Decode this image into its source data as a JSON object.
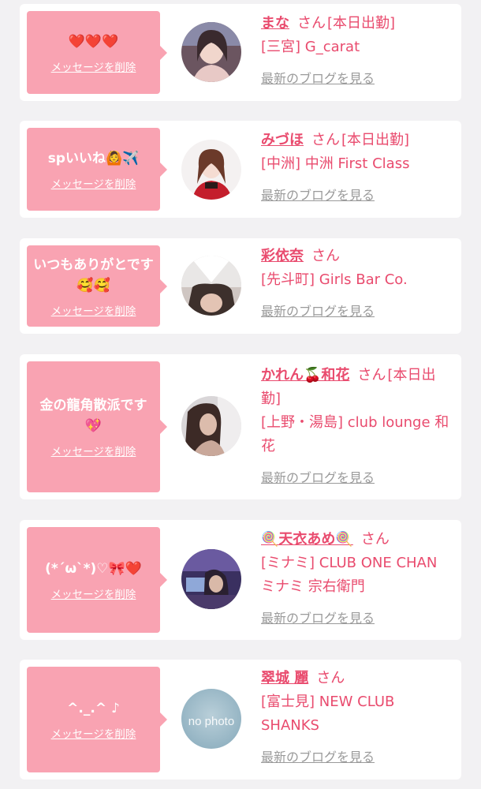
{
  "colors": {
    "page_bg": "#f2f1f3",
    "bubble": "#f9a3b2",
    "accent": "#e94b6e",
    "link_gray": "#9a9a9a"
  },
  "delete_label": "メッセージを削除",
  "blog_label": "最新のブログを見る",
  "san_label": "さん",
  "items": [
    {
      "message": "❤️❤️❤️",
      "name": "まな",
      "status": "[本日出勤]",
      "shop": "[三宮] G_carat",
      "avatar_icon": "cast-photo"
    },
    {
      "message": "spいいね🙆✈️",
      "name": "みづほ",
      "status": "[本日出勤]",
      "shop": "[中洲] 中洲 First Class",
      "avatar_icon": "cast-photo"
    },
    {
      "message": "いつもありがとです🥰🥰",
      "name": "彩依奈",
      "status": "",
      "shop": "[先斗町] Girls Bar Co.",
      "avatar_icon": "cast-photo"
    },
    {
      "message": "金の龍角散派です💖",
      "name": "かれん🍒和花",
      "status": "[本日出勤]",
      "shop": "[上野・湯島] club lounge 和花",
      "avatar_icon": "cast-photo"
    },
    {
      "message": "(*´ω`*)♡🎀❤️",
      "name": "🍭天衣あめ🍭",
      "status": "",
      "shop": "[ミナミ] CLUB ONE CHAN ミナミ 宗右衛門",
      "avatar_icon": "cast-photo"
    },
    {
      "message": "^._.^ ♪",
      "name": "翠城 麗",
      "status": "",
      "shop": "[富士見] NEW CLUB SHANKS",
      "avatar_icon": "no-photo",
      "avatar_text": "no photo"
    }
  ]
}
